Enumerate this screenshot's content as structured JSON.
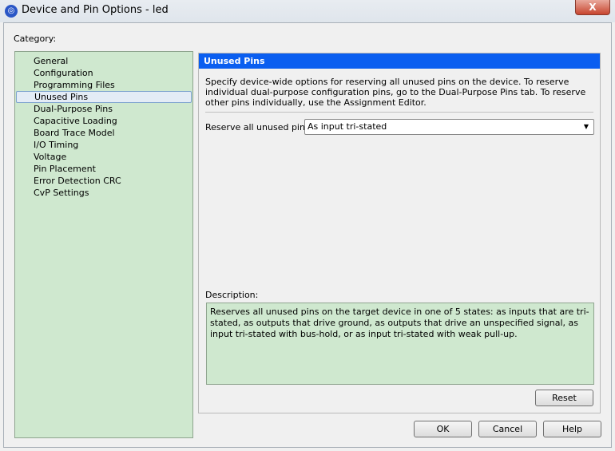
{
  "window": {
    "title": "Device and Pin Options - led",
    "close_label": "X"
  },
  "category_label": "Category:",
  "categories": [
    "General",
    "Configuration",
    "Programming Files",
    "Unused Pins",
    "Dual-Purpose Pins",
    "Capacitive Loading",
    "Board Trace Model",
    "I/O Timing",
    "Voltage",
    "Pin Placement",
    "Error Detection CRC",
    "CvP Settings"
  ],
  "selected_category": "Unused Pins",
  "panel": {
    "header": "Unused Pins",
    "intro": "Specify device-wide options for reserving all unused pins on the device. To reserve individual dual-purpose configuration pins, go to the Dual-Purpose Pins tab. To reserve other pins individually, use the Assignment Editor.",
    "reserve_label": "Reserve all unused pins:",
    "reserve_value": "As input tri-stated",
    "description_label": "Description:",
    "description": "Reserves all unused pins on the target device in one of 5 states: as inputs that are tri-stated, as outputs that drive ground, as outputs that drive an unspecified signal, as input tri-stated with bus-hold, or as input tri-stated with weak pull-up.",
    "reset": "Reset"
  },
  "buttons": {
    "ok": "OK",
    "cancel": "Cancel",
    "help": "Help"
  },
  "colors": {
    "header": "#0a5ef0",
    "list_bg": "#cfe8cf"
  }
}
